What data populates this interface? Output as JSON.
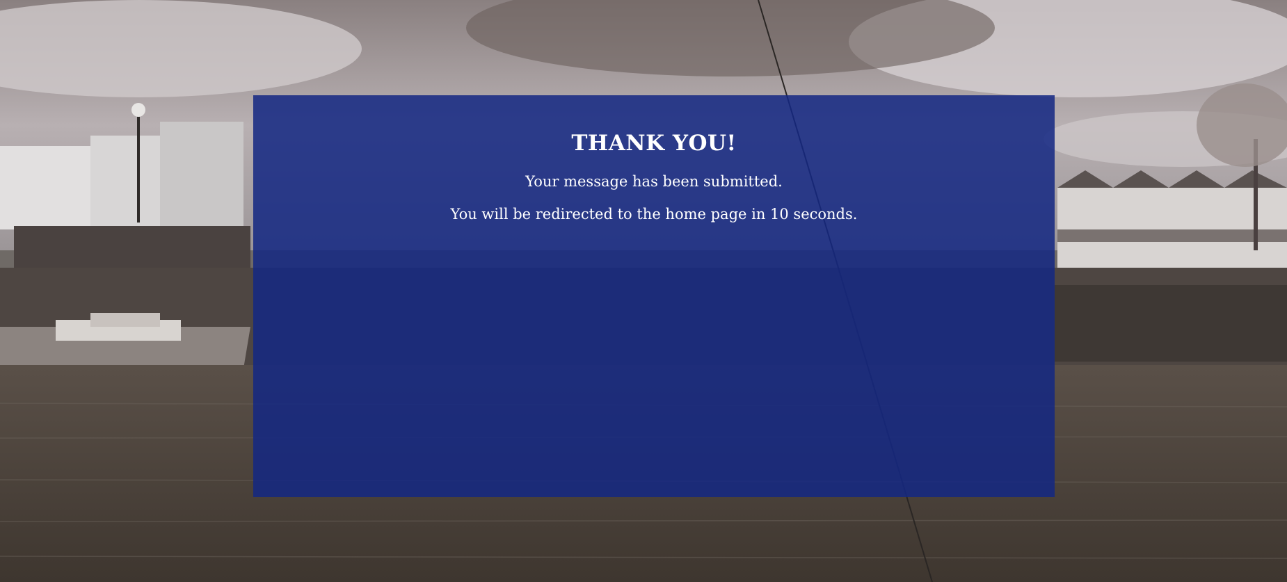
{
  "confirmation": {
    "heading": "THANK YOU!",
    "message": "Your message has been submitted.",
    "redirect_notice": "You will be redirected to the home page in 10 seconds."
  },
  "background": {
    "description_icon": "harbour-photo",
    "overlay_color": "#14288a"
  }
}
